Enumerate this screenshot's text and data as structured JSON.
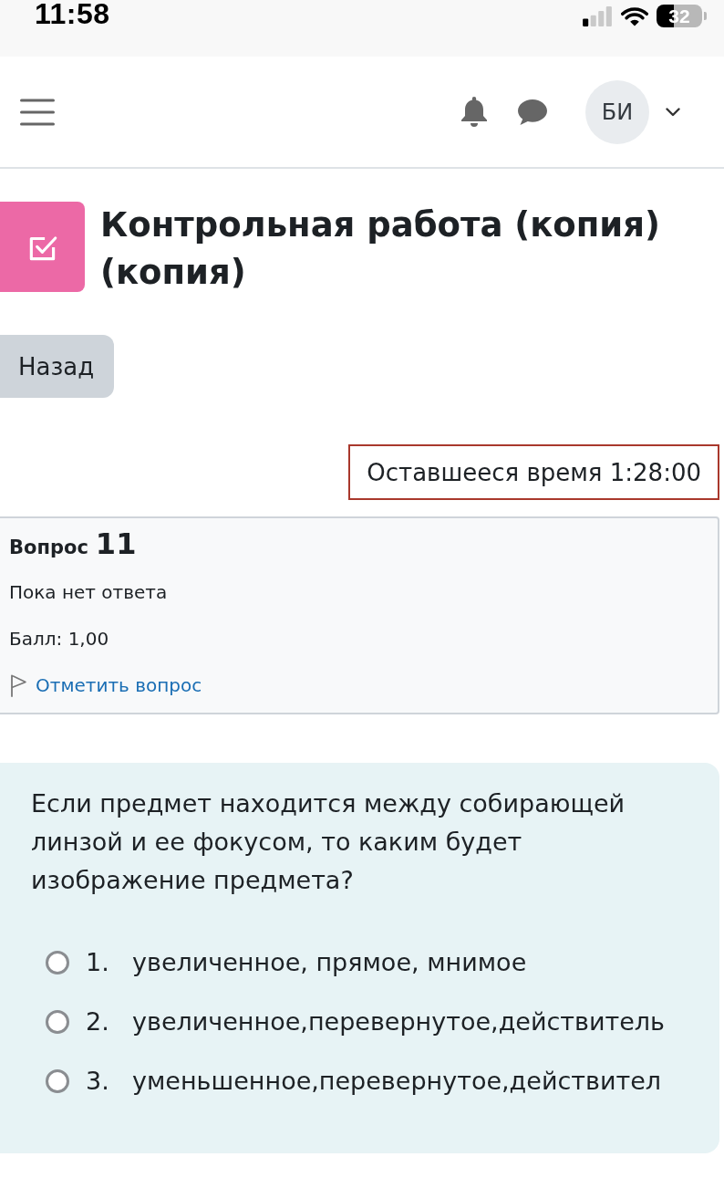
{
  "status_bar": {
    "time": "11:58",
    "battery": "32"
  },
  "navbar": {
    "avatar_initials": "БИ"
  },
  "activity": {
    "title": "Контрольная работа (копия) (копия)",
    "back_button": "Назад"
  },
  "timer": "Оставшееся время 1:28:00",
  "question_info": {
    "label": "Вопрос",
    "number": "11",
    "status": "Пока нет ответа",
    "mark": "Балл: 1,00",
    "flag_link": "Отметить вопрос"
  },
  "question": {
    "text": "Если предмет находится между собирающей линзой и ее фокусом, то каким будет изображение предмета?",
    "options": [
      {
        "number": "1.",
        "text": "увеличенное, прямое, мнимое",
        "selected": false
      },
      {
        "number": "2.",
        "text": "увеличенное,перевернутое,действитель",
        "selected": false
      },
      {
        "number": "3.",
        "text": "уменьшенное,перевернутое,действител",
        "selected": false
      }
    ]
  }
}
